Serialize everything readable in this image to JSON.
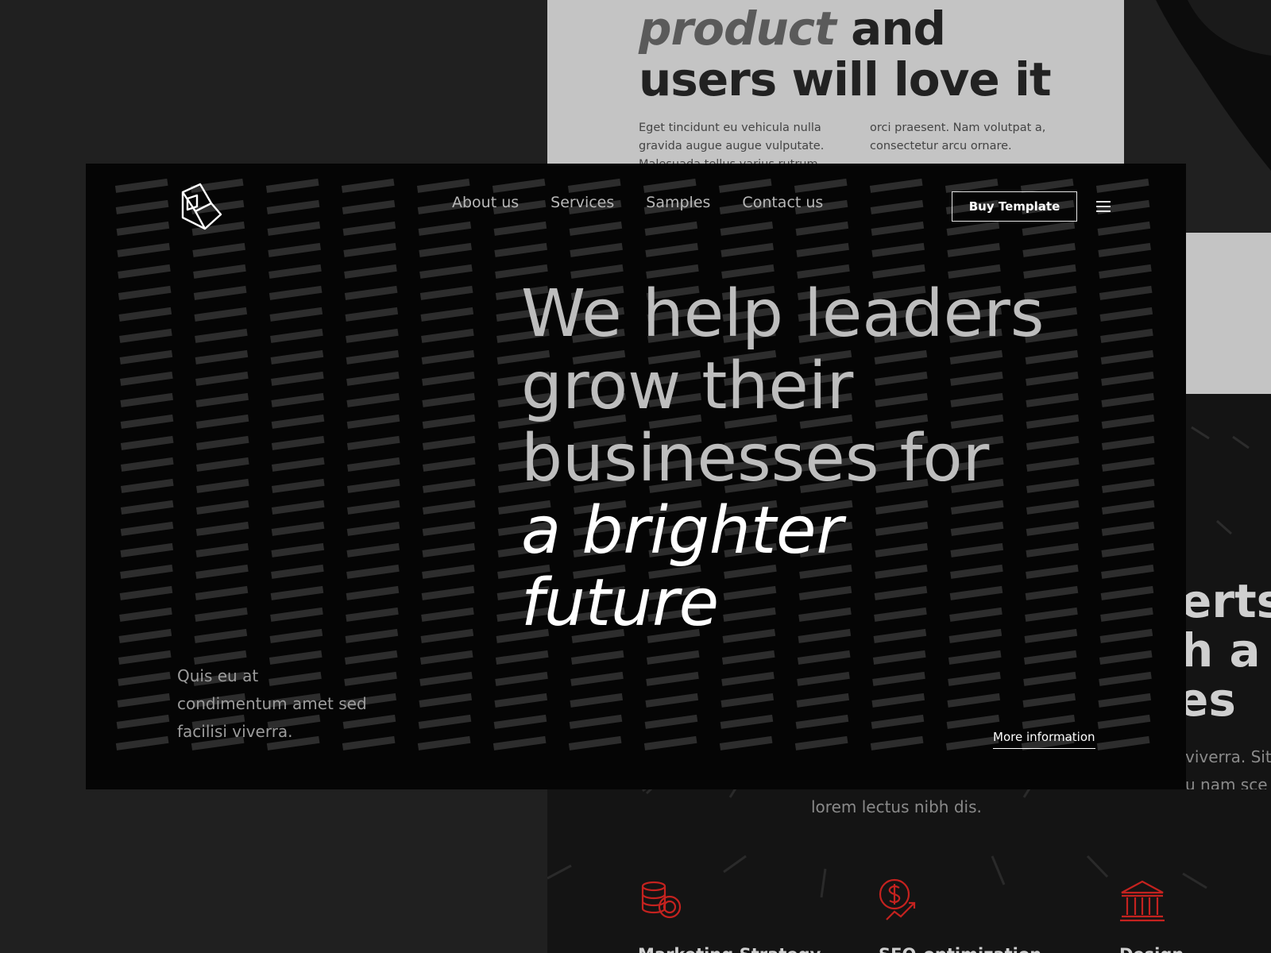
{
  "background": {
    "top_mock": {
      "heading_em": "product",
      "heading_rest": " and",
      "heading_line2": "users will love it",
      "col1": "Eget tincidunt eu vehicula nulla gravida augue augue vulputate. Malesuada tellus varius rutrum",
      "col2": "orci praesent. Nam volutpat a, consectetur arcu ornare."
    },
    "right_mock": {
      "line1": "erts",
      "line2": "h a",
      "line3": "es",
      "small1": "viverra. Sit",
      "small2": "u nam sce"
    },
    "bottom_mock": {
      "caption": "lorem lectus nibh dis.",
      "services": [
        {
          "label": "Marketing Strategy",
          "icon": "coins-icon"
        },
        {
          "label": "SEO-optimization",
          "icon": "dollar-growth-icon"
        },
        {
          "label": "Design",
          "icon": "bank-icon"
        }
      ]
    },
    "accent_color": "#c4221f"
  },
  "hero": {
    "logo_icon": "cube-logo-icon",
    "nav": [
      "About us",
      "Services",
      "Samples",
      "Contact us"
    ],
    "buy_button": "Buy Template",
    "menu_icon": "hamburger-icon",
    "headline": {
      "line1": "We help leaders",
      "line2": "grow their",
      "line3": "businesses for",
      "line4": "a brighter",
      "line5": "future"
    },
    "tagline": "Quis eu at condimentum amet sed facilisi viverra.",
    "more_link": "More information"
  }
}
